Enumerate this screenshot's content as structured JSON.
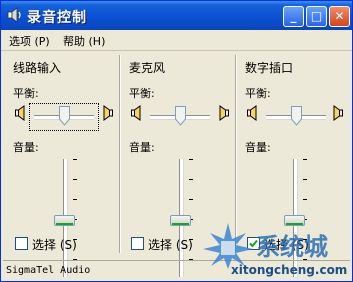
{
  "window": {
    "title": "录音控制",
    "buttons": [
      "_",
      "□",
      "✕"
    ],
    "colors": {
      "titlebar": "#0a4fd1",
      "face": "#ece9d8",
      "thumb_accent": "#21a121"
    }
  },
  "menu": [
    {
      "label": "选项",
      "hotkey": "(P)"
    },
    {
      "label": "帮助",
      "hotkey": "(H)"
    }
  ],
  "labels": {
    "balance": "平衡:",
    "volume": "音量:"
  },
  "channels": [
    {
      "name": "线路输入",
      "select_label": "选择",
      "hotkey": "(S)",
      "selected": false,
      "balance": 0,
      "volume": 0
    },
    {
      "name": "麦克风",
      "select_label": "选择",
      "hotkey": "(S)",
      "selected": false,
      "balance": 0,
      "volume": 0
    },
    {
      "name": "数字插口",
      "select_label": "选择",
      "hotkey": "(S)",
      "selected": true,
      "balance": 0,
      "volume": 0
    }
  ],
  "status": "SigmaTel Audio",
  "watermark": {
    "text": "系统城",
    "url": "xitongcheng.com"
  }
}
